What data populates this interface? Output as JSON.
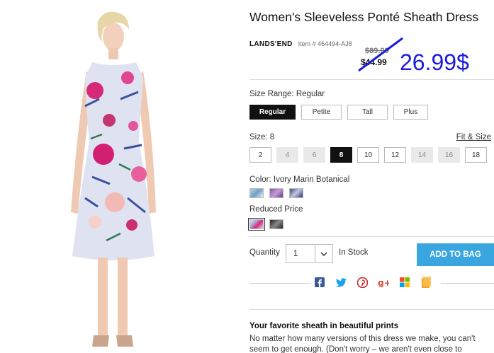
{
  "product": {
    "title": "Women's Sleeveless Ponté Sheath Dress",
    "brand": "LANDS'END",
    "item_number": "Item # 464494-AJ8",
    "old_price": "$89.00",
    "current_price": "$44.99",
    "handwritten_price": "26.99$",
    "handwritten_color": "#1a1ae0"
  },
  "size_range": {
    "label": "Size Range: Regular",
    "options": [
      {
        "label": "Regular",
        "selected": true
      },
      {
        "label": "Petite",
        "selected": false
      },
      {
        "label": "Tall",
        "selected": false
      },
      {
        "label": "Plus",
        "selected": false
      }
    ]
  },
  "size": {
    "label": "Size: 8",
    "fit_link": "Fit & Size",
    "options": [
      {
        "label": "2",
        "state": "available"
      },
      {
        "label": "4",
        "state": "unavailable"
      },
      {
        "label": "6",
        "state": "unavailable"
      },
      {
        "label": "8",
        "state": "selected"
      },
      {
        "label": "10",
        "state": "available"
      },
      {
        "label": "12",
        "state": "available"
      },
      {
        "label": "14",
        "state": "unavailable"
      },
      {
        "label": "16",
        "state": "unavailable"
      },
      {
        "label": "18",
        "state": "available"
      }
    ]
  },
  "color": {
    "label": "Color: Ivory Marin Botanical",
    "reduced_label": "Reduced Price"
  },
  "quantity": {
    "label": "Quantity",
    "value": "1",
    "stock": "In Stock"
  },
  "add_to_bag": "ADD TO BAG",
  "accent_color": "#3aa6e0",
  "share_icons": [
    "facebook-icon",
    "twitter-icon",
    "pinterest-icon",
    "google-plus-icon",
    "windows-live-icon",
    "email-icon"
  ],
  "description": {
    "heading": "Your favorite sheath in beautiful prints",
    "body": "No matter how many versions of this dress we make, you can't seem to get enough. (Don't worry – we aren't even close to"
  }
}
